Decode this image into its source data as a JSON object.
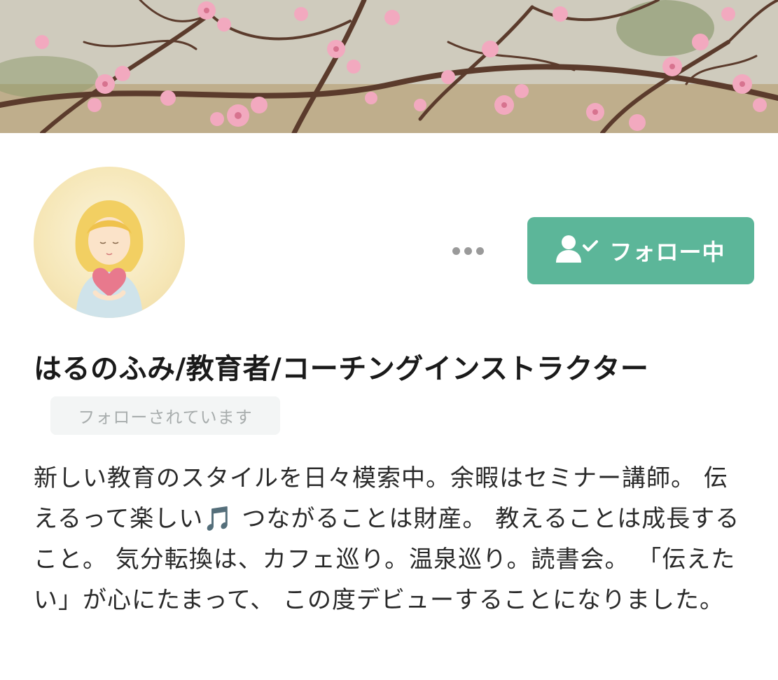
{
  "profile": {
    "name": "はるのふみ/教育者/コーチングインストラクター",
    "followed_by_badge": "フォローされています",
    "bio": "新しい教育のスタイルを日々模索中。余暇はセミナー講師。 伝えるって楽しい🎵 つながることは財産。 教えることは成長すること。 気分転換は、カフェ巡り。温泉巡り。読書会。 「伝えたい」が心にたまって、 この度デビューすることになりました。"
  },
  "actions": {
    "more_icon": "more-horizontal-icon",
    "follow_label": "フォロー中",
    "follow_icon": "user-check-icon"
  },
  "colors": {
    "accent": "#5cb699",
    "badge_bg": "#f3f5f5",
    "badge_text": "#a8adad"
  }
}
